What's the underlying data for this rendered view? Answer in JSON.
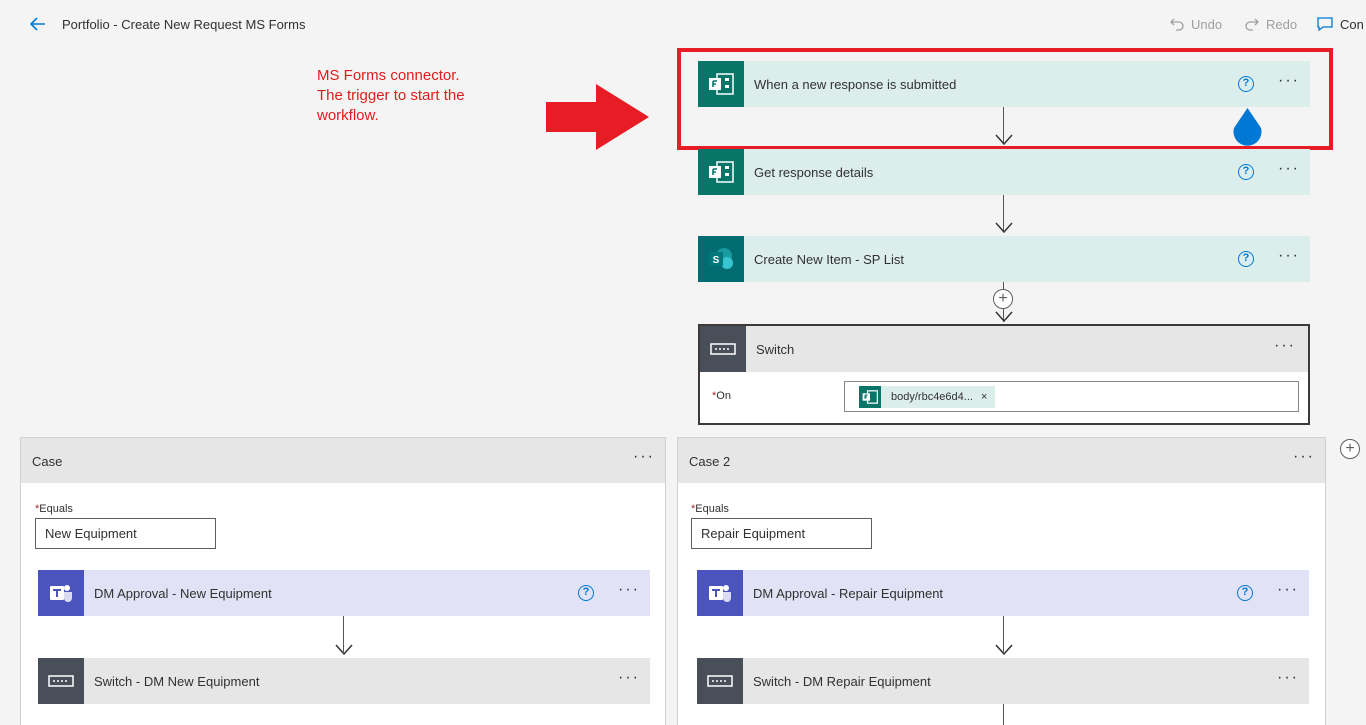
{
  "topbar": {
    "title": "Portfolio - Create New Request MS Forms",
    "undo": "Undo",
    "redo": "Redo",
    "comments": "Con"
  },
  "annotation": {
    "text_lines": [
      "MS Forms connector.",
      "The trigger to start the",
      "workflow."
    ],
    "color": "#e01c1c"
  },
  "flow": {
    "trigger": {
      "label": "When a new response is submitted",
      "icon": "forms-icon"
    },
    "get_details": {
      "label": "Get response details",
      "icon": "forms-icon"
    },
    "create_item": {
      "label": "Create New Item - SP List",
      "icon": "sharepoint-icon"
    },
    "switch": {
      "label": "Switch",
      "on_label": "On",
      "token_text": "body/rbc4e6d4...",
      "token_remove": "×"
    }
  },
  "cases": [
    {
      "title": "Case",
      "equals_label": "Equals",
      "equals_value": "New Equipment",
      "approval": "DM Approval - New Equipment",
      "switch": "Switch - DM New Equipment"
    },
    {
      "title": "Case 2",
      "equals_label": "Equals",
      "equals_value": "Repair Equipment",
      "approval": "DM Approval - Repair Equipment",
      "switch": "Switch - DM Repair Equipment"
    }
  ],
  "colors": {
    "forms_teal": "#077568",
    "teams_purple": "#4b53bc",
    "control_gray": "#484f58",
    "highlight_red": "#e81c25",
    "accent_blue": "#0078d4"
  }
}
